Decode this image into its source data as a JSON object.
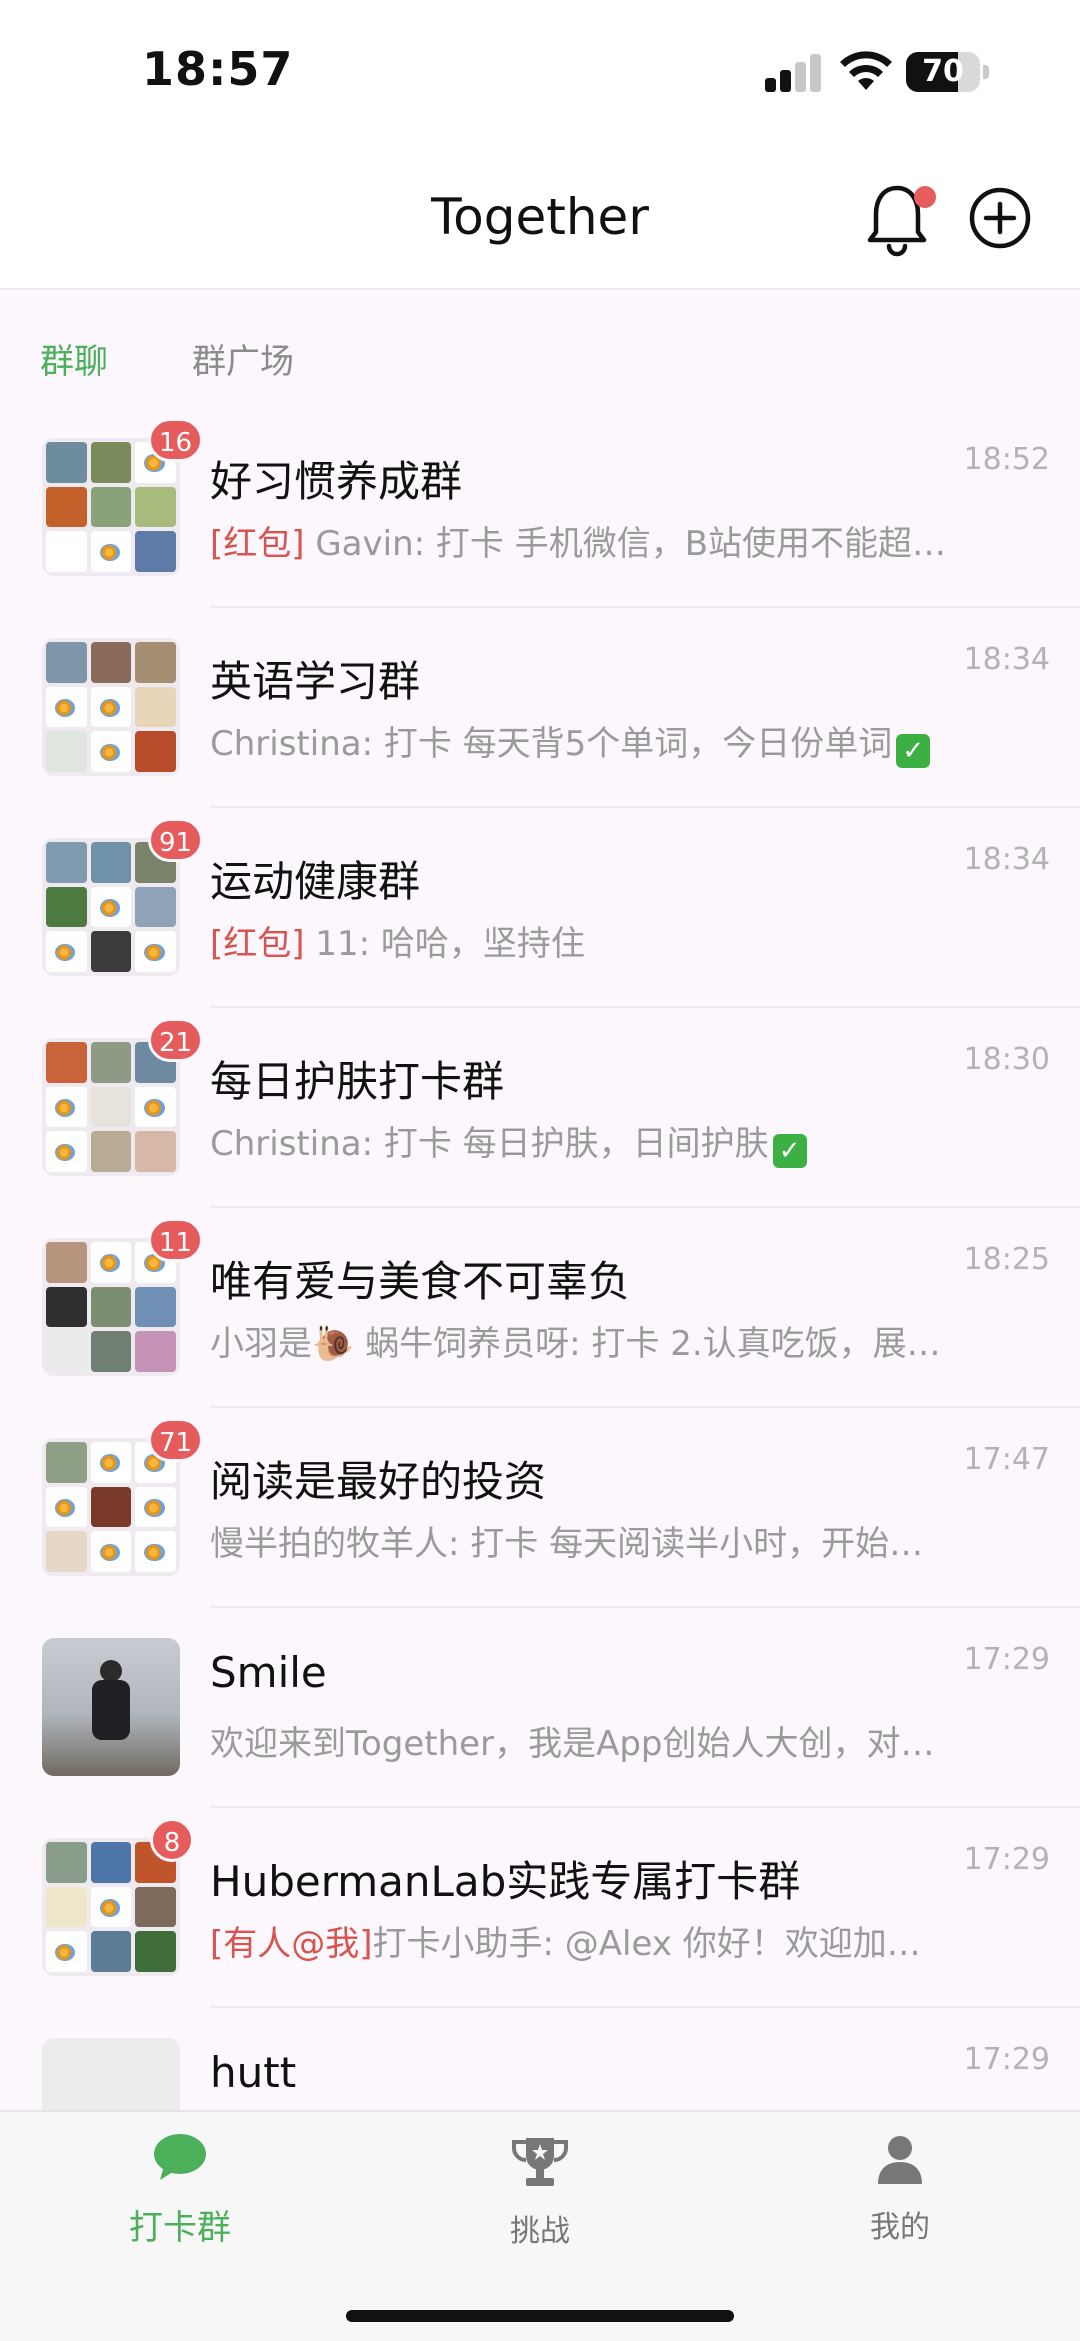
{
  "status_bar": {
    "time": "18:57",
    "battery": "70",
    "battery_level": 0.7
  },
  "header": {
    "title": "Together",
    "bell_has_dot": true
  },
  "tabs": [
    {
      "label": "群聊",
      "active": true
    },
    {
      "label": "群广场",
      "active": false
    }
  ],
  "chats": [
    {
      "name": "好习惯养成群",
      "time": "18:52",
      "badge": "16",
      "tag": "[红包]",
      "preview": " Gavin: 打卡 手机微信，B站使用不能超…"
    },
    {
      "name": "英语学习群",
      "time": "18:34",
      "badge": "",
      "tag": "",
      "preview": "Christina: 打卡 每天背5个单词，今日份单词",
      "check": "✓"
    },
    {
      "name": "运动健康群",
      "time": "18:34",
      "badge": "91",
      "tag": "[红包]",
      "preview": " 11: 哈哈，坚持住"
    },
    {
      "name": "每日护肤打卡群",
      "time": "18:30",
      "badge": "21",
      "tag": "",
      "preview": "Christina: 打卡 每日护肤，日间护肤",
      "check": "✓"
    },
    {
      "name": "唯有爱与美食不可辜负",
      "time": "18:25",
      "badge": "11",
      "tag": "",
      "preview": "小羽是🐌 蜗牛饲养员呀: 打卡 2.认真吃饭，展…"
    },
    {
      "name": "阅读是最好的投资",
      "time": "17:47",
      "badge": "71",
      "tag": "",
      "preview": "慢半拍的牧羊人: 打卡 每天阅读半小时，开始…"
    },
    {
      "name": "Smile",
      "time": "17:29",
      "badge": "",
      "tag": "",
      "preview": "欢迎来到Together，我是App创始人大创，对…"
    },
    {
      "name": "HubermanLab实践专属打卡群",
      "time": "17:29",
      "badge": "8",
      "tag": "[有人@我]",
      "preview": "打卡小助手: @Alex 你好！欢迎加…"
    },
    {
      "name": "hutt",
      "time": "17:29",
      "badge": "",
      "tag": "",
      "preview": ""
    }
  ],
  "tab_bar": [
    {
      "label": "打卡群",
      "icon": "chat-bubble-icon",
      "active": true
    },
    {
      "label": "挑战",
      "icon": "trophy-icon",
      "active": false
    },
    {
      "label": "我的",
      "icon": "person-icon",
      "active": false
    }
  ],
  "colors": {
    "accent": "#4caf5a",
    "badge": "#e65c5c",
    "tag": "#d9534f",
    "background": "#fbf7fc"
  }
}
